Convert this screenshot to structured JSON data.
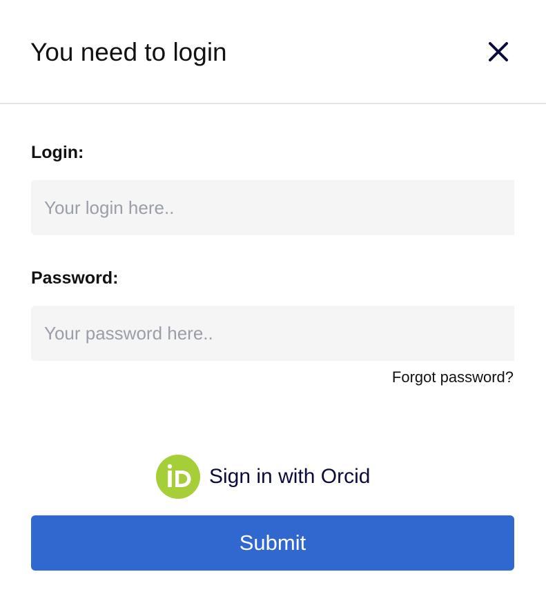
{
  "modal": {
    "title": "You need to login",
    "close_icon": "close-icon"
  },
  "login": {
    "label": "Login:",
    "value": "",
    "placeholder": "Your login here.."
  },
  "password": {
    "label": "Password:",
    "value": "",
    "placeholder": "Your password here.."
  },
  "forgot_password": {
    "label": "Forgot password?"
  },
  "orcid": {
    "logo_text": "iD",
    "label": "Sign in with Orcid",
    "icon": "orcid-icon",
    "brand_color": "#a6ce39"
  },
  "submit": {
    "label": "Submit",
    "color": "#3068d0"
  }
}
